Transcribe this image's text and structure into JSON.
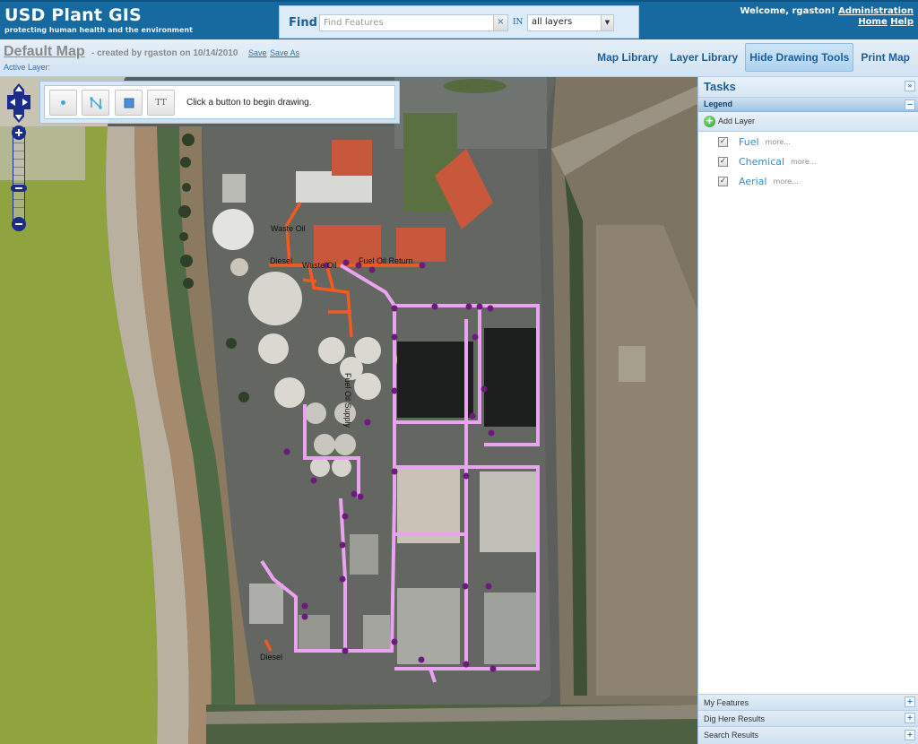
{
  "header": {
    "app_title": "USD Plant GIS",
    "tagline": "protecting human health and the environment",
    "find": {
      "label": "Find",
      "placeholder": "Find Features",
      "value": "",
      "clear_icon": "×",
      "in_label": "IN",
      "scope_selected": "all layers",
      "dropdown_icon": "▼"
    },
    "user": {
      "welcome": "Welcome, rgaston!",
      "admin_link": "Administration",
      "home_link": "Home",
      "help_link": "Help"
    }
  },
  "subheader": {
    "map_title": "Default Map",
    "meta": "- created by rgaston on 10/14/2010",
    "save": "Save",
    "save_as": "Save As",
    "active_layer_label": "Active Layer:",
    "nav": [
      {
        "label": "Map Library",
        "active": false
      },
      {
        "label": "Layer Library",
        "active": false
      },
      {
        "label": "Hide Drawing Tools",
        "active": true
      },
      {
        "label": "Print Map",
        "active": false
      }
    ]
  },
  "drawing_toolbar": {
    "buttons": [
      {
        "name": "point",
        "icon": "point-icon"
      },
      {
        "name": "line",
        "icon": "polyline-icon"
      },
      {
        "name": "polygon",
        "icon": "polygon-icon"
      },
      {
        "name": "text",
        "icon": "text-icon",
        "glyph": "TT"
      }
    ],
    "hint": "Click a button to begin drawing."
  },
  "map": {
    "labels": [
      {
        "text": "Waste Oil"
      },
      {
        "text": "Diesel"
      },
      {
        "text": "Waste Oil"
      },
      {
        "text": "Fuel Oil Return"
      },
      {
        "text": "Fuel Oil Supply"
      },
      {
        "text": "Diesel"
      }
    ],
    "colors": {
      "fuel_line": "#f25a1e",
      "chemical_line": "#e9a4ef",
      "chemical_node": "#6d1a7d"
    }
  },
  "panel": {
    "tasks_title": "Tasks",
    "collapse_icon": "»",
    "legend_title": "Legend",
    "legend_toggle": "−",
    "add_layer": "Add Layer",
    "layers": [
      {
        "name": "Fuel",
        "checked": true,
        "more": "more..."
      },
      {
        "name": "Chemical",
        "checked": true,
        "more": "more..."
      },
      {
        "name": "Aerial",
        "checked": true,
        "more": "more..."
      }
    ],
    "accordions": [
      {
        "label": "My Features",
        "icon": "+"
      },
      {
        "label": "Dig Here Results",
        "icon": "+"
      },
      {
        "label": "Search Results",
        "icon": "+"
      }
    ]
  },
  "colors": {
    "header_bg": "#166aa0",
    "link_blue": "#1b5f9a",
    "nav_zoom_blue": "#1b2c8a"
  }
}
